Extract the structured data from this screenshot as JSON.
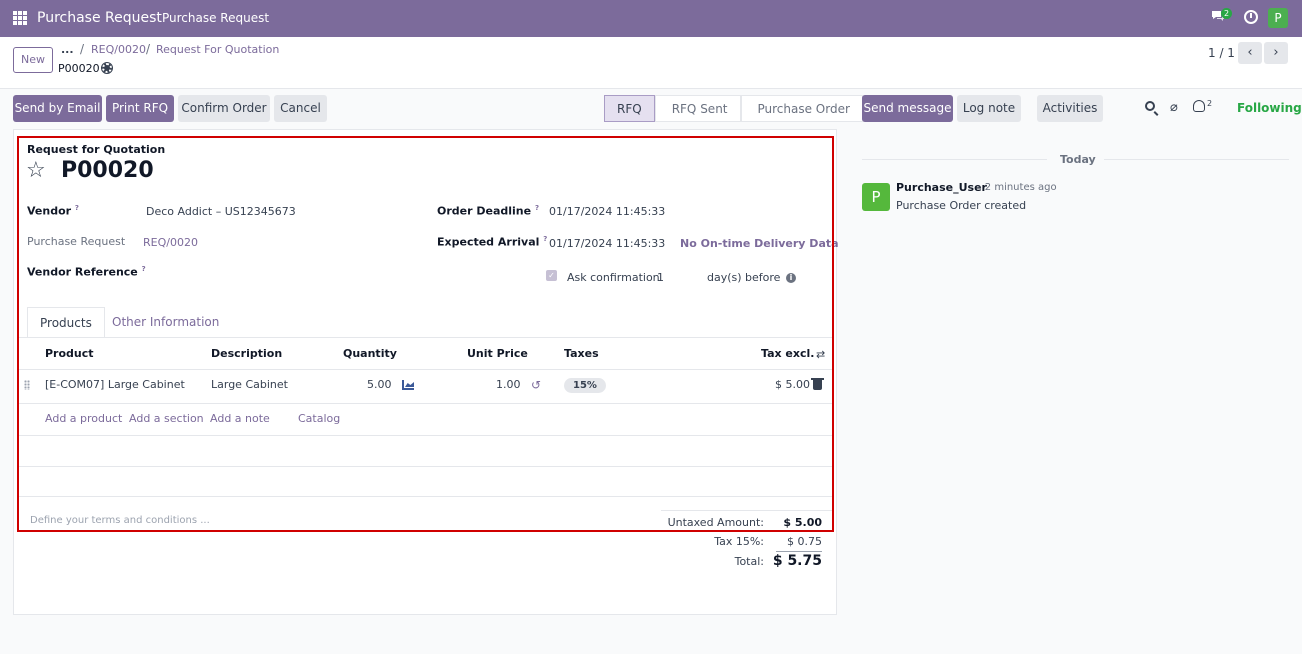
{
  "topbar": {
    "app_title": "Purchase Request",
    "menu_item": "Purchase Request",
    "chat_count": "2",
    "avatar_letter": "P"
  },
  "control_panel": {
    "new_button": "New",
    "breadcrumb_more": "...",
    "breadcrumb_sep": "/",
    "breadcrumb_req": "REQ/0020",
    "breadcrumb_rfq": "Request For Quotation",
    "record_name": "P00020",
    "pager": "1 / 1"
  },
  "actions": {
    "send_email": "Send by Email",
    "print_rfq": "Print RFQ",
    "confirm": "Confirm Order",
    "cancel": "Cancel"
  },
  "statusbar": [
    "RFQ",
    "RFQ Sent",
    "Purchase Order"
  ],
  "form": {
    "doc_type": "Request for Quotation",
    "name": "P00020",
    "vendor_label": "Vendor",
    "vendor_value": "Deco Addict – US12345673",
    "purchase_request_label": "Purchase Request",
    "purchase_request_value": "REQ/0020",
    "vendor_ref_label": "Vendor Reference",
    "order_deadline_label": "Order Deadline",
    "order_deadline_value": "01/17/2024 11:45:33",
    "expected_arrival_label": "Expected Arrival",
    "expected_arrival_value": "01/17/2024 11:45:33",
    "ontime_link": "No On-time Delivery Data",
    "ask_confirmation_label": "Ask confirmation",
    "ask_confirmation_days": "1",
    "days_before": "day(s) before",
    "help_mark": "?"
  },
  "tabs": [
    "Products",
    "Other Information"
  ],
  "lines": {
    "headers": {
      "product": "Product",
      "description": "Description",
      "quantity": "Quantity",
      "unit_price": "Unit Price",
      "taxes": "Taxes",
      "tax_excl": "Tax excl."
    },
    "rows": [
      {
        "product": "[E-COM07] Large Cabinet",
        "description": "Large Cabinet",
        "quantity": "5.00",
        "unit_price": "1.00",
        "taxes": "15%",
        "subtotal": "$ 5.00"
      }
    ],
    "add_product": "Add a product",
    "add_section": "Add a section",
    "add_note": "Add a note",
    "catalog": "Catalog"
  },
  "terms_placeholder": "Define your terms and conditions ...",
  "totals": {
    "untaxed_label": "Untaxed Amount:",
    "untaxed_value": "$ 5.00",
    "tax_label": "Tax 15%:",
    "tax_value": "$ 0.75",
    "total_label": "Total:",
    "total_value": "$ 5.75"
  },
  "chatter": {
    "send_message": "Send message",
    "log_note": "Log note",
    "activities": "Activities",
    "followers_count": "2",
    "following": "Following",
    "today": "Today",
    "message": {
      "author": "Purchase_User",
      "time": "- 2 minutes ago",
      "body": "Purchase Order created",
      "avatar_letter": "P"
    }
  },
  "colors": {
    "brand": "#7c6b9b",
    "following": "#28a745",
    "highlight": "#d00000"
  }
}
